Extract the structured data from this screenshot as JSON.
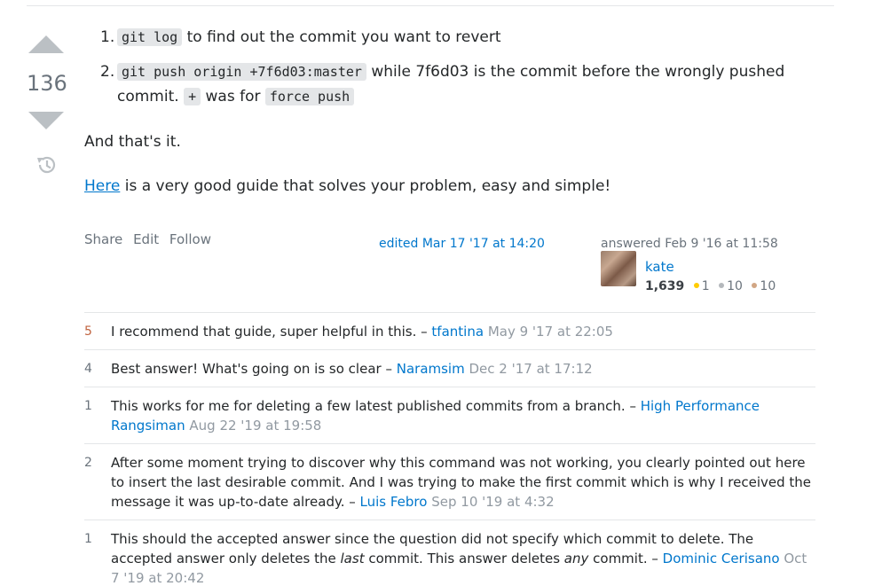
{
  "vote": {
    "count": "136"
  },
  "answer": {
    "steps": [
      {
        "num": "1.",
        "code1": "git log",
        "text1": " to find out the commit you want to revert"
      },
      {
        "num": "2.",
        "code1": "git push origin +7f6d03:master",
        "text1": " while 7f6d03 is the commit before the wrongly pushed commit. ",
        "code2": "+",
        "text2": " was for ",
        "code3": "force push"
      }
    ],
    "para1": "And that's it.",
    "link_text": "Here",
    "para2_rest": " is a very good guide that solves your problem, easy and simple!"
  },
  "menu": {
    "share": "Share",
    "edit": "Edit",
    "follow": "Follow"
  },
  "edited": "edited Mar 17 '17 at 14:20",
  "owner": {
    "answered": "answered Feb 9 '16 at 11:58",
    "name": "kate",
    "rep": "1,639",
    "gold": "1",
    "silver": "10",
    "bronze": "10"
  },
  "comments": [
    {
      "score": "5",
      "text": "I recommend that guide, super helpful in this. – ",
      "user": "tfantina",
      "date": "May 9 '17 at 22:05"
    },
    {
      "score": "4",
      "text": "Best answer! What's going on is so clear – ",
      "user": "Naramsim",
      "date": "Dec 2 '17 at 17:12"
    },
    {
      "score": "1",
      "text": "This works for me for deleting a few latest published commits from a branch. – ",
      "user": "High Performance Rangsiman",
      "date": "Aug 22 '19 at 19:58"
    },
    {
      "score": "2",
      "text": "After some moment trying to discover why this command was not working, you clearly pointed out here to insert the last desirable commit. And I was trying to make the first commit which is why I received the message it was up-to-date already. – ",
      "user": "Luis Febro",
      "date": "Sep 10 '19 at 4:32"
    },
    {
      "score": "1",
      "text_a": "This should the accepted answer since the question did not specify which commit to delete. The accepted answer only deletes the ",
      "em1": "last",
      "text_b": " commit. This answer deletes ",
      "em2": "any",
      "text_c": " commit. – ",
      "user": "Dominic Cerisano",
      "date": "Oct 7 '19 at 20:42"
    }
  ],
  "colors": {
    "link": "#0077cc",
    "code_bg": "#e4e6e8",
    "vote_arrow": "#bbc0c4",
    "hot_score": "#c0633f"
  }
}
